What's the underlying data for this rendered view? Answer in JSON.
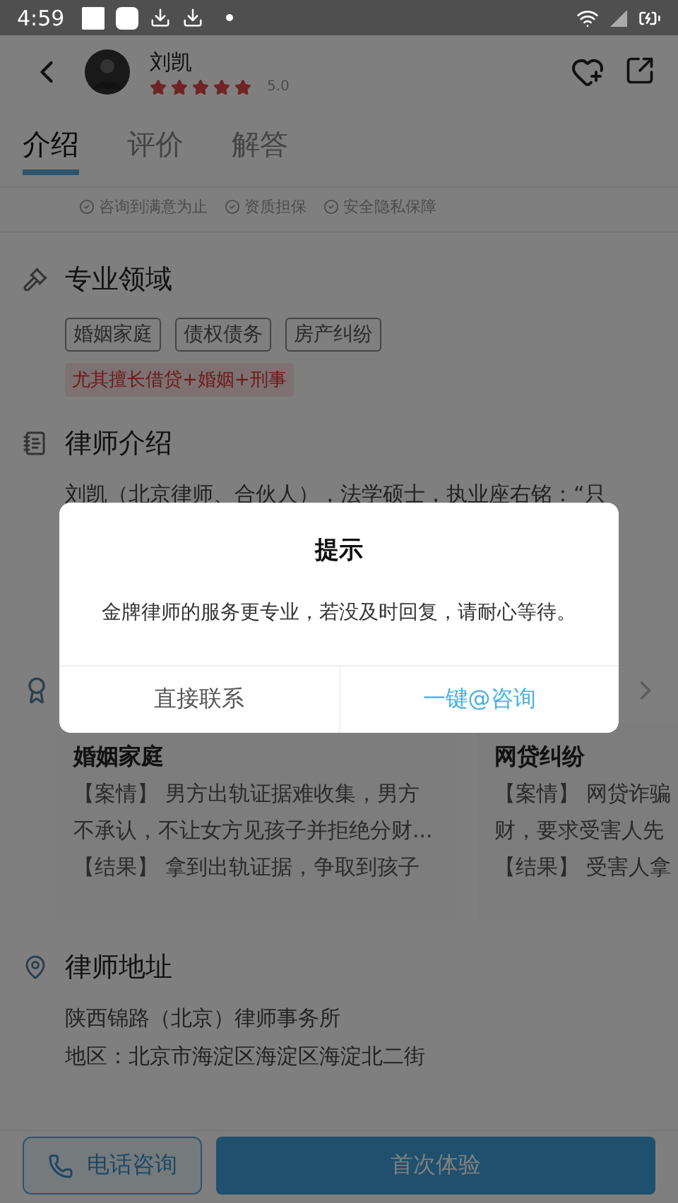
{
  "status_bar": {
    "time": "4:59"
  },
  "header": {
    "name": "刘凯",
    "stars": 5,
    "rating": "5.0"
  },
  "tabs": [
    {
      "label": "介绍",
      "selected": true
    },
    {
      "label": "评价",
      "selected": false
    },
    {
      "label": "解答",
      "selected": false
    }
  ],
  "guarantees": [
    "咨询到满意为止",
    "资质担保",
    "安全隐私保障"
  ],
  "specialty": {
    "title": "专业领域",
    "tags": [
      "婚姻家庭",
      "债权债务",
      "房产纠纷"
    ],
    "highlight": "尤其擅长借贷+婚姻+刑事"
  },
  "intro": {
    "title": "律师介绍",
    "text": "刘凯（北京律师、合伙人），法学硕士，执业座右铭：“只"
  },
  "cases": [
    {
      "title": "婚姻家庭",
      "lines": [
        "【案情】 男方出轨证据难收集，男方",
        "不承认，不让女方见孩子并拒绝分财...",
        "【结果】 拿到出轨证据，争取到孩子"
      ]
    },
    {
      "title": "网贷纠纷",
      "lines": [
        "【案情】 网贷诈骗",
        "财，要求受害人先",
        "【结果】 受害人拿"
      ]
    }
  ],
  "address": {
    "title": "律师地址",
    "lines": [
      "陕西锦路（北京）律师事务所",
      "地区：北京市海淀区海淀区海淀北二街"
    ]
  },
  "bottom_bar": {
    "phone_button": "电话咨询",
    "main_button": "首次体验"
  },
  "dialog": {
    "title": "提示",
    "message": "金牌律师的服务更专业，若没及时回复，请耐心等待。",
    "buttons": [
      {
        "label": "直接联系",
        "kind": "plain"
      },
      {
        "label": "一键@咨询",
        "kind": "primary"
      }
    ]
  }
}
